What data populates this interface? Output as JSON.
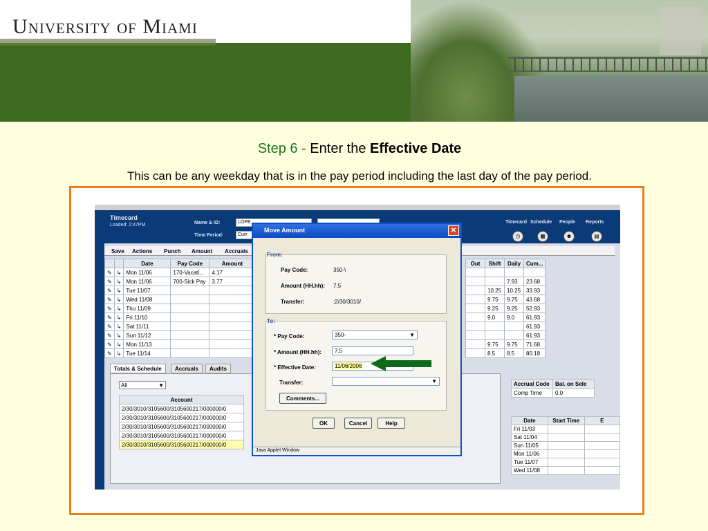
{
  "banner": {
    "logo": "University of Miami"
  },
  "heading": {
    "step": "Step 6 -",
    "text": "Enter the",
    "bold": "Effective Date"
  },
  "subtext": "This can be any weekday that is in the pay period including the last day of the pay period.",
  "app": {
    "title": "Timecard",
    "loaded": "Loaded: 2:47PM",
    "name_label": "Name & ID:",
    "name_value": "LOPE",
    "period_label": "Time Period:",
    "period_value": "Curr",
    "nav": [
      "Timecard",
      "Schedule",
      "People",
      "Reports"
    ],
    "menu": [
      "Save",
      "Actions",
      "Punch",
      "Amount",
      "Accruals"
    ],
    "grid_headers": [
      "Date",
      "Pay Code",
      "Amount"
    ],
    "grid_rows": [
      [
        "Mon 11/06",
        "170-Vacati...",
        "4.17"
      ],
      [
        "Mon 11/06",
        "700-Sick Pay",
        "3.77"
      ],
      [
        "Tue 11/07",
        "",
        ""
      ],
      [
        "Wed 11/08",
        "",
        ""
      ],
      [
        "Thu 11/09",
        "",
        ""
      ],
      [
        "Fri 11/10",
        "",
        ""
      ],
      [
        "Sat 11/11",
        "",
        ""
      ],
      [
        "Sun 11/12",
        "",
        ""
      ],
      [
        "Mon 11/13",
        "",
        ""
      ],
      [
        "Tue 11/14",
        "",
        ""
      ]
    ],
    "grid2_headers": [
      "Out",
      "Shift",
      "Daily",
      "Cum..."
    ],
    "grid2_rows": [
      [
        "",
        "",
        "",
        ""
      ],
      [
        "",
        "",
        "7.93",
        "23.68"
      ],
      [
        "",
        "10.25",
        "10.25",
        "33.93"
      ],
      [
        "",
        "9.75",
        "9.75",
        "43.68"
      ],
      [
        "",
        "9.25",
        "9.25",
        "52.93"
      ],
      [
        "",
        "9.0",
        "9.0",
        "61.93"
      ],
      [
        "",
        "",
        "",
        "61.93"
      ],
      [
        "",
        "",
        "",
        "61.93"
      ],
      [
        "",
        "9.75",
        "9.75",
        "71.68"
      ],
      [
        "",
        "8.5",
        "8.5",
        "80.18"
      ]
    ],
    "lower_tabs": [
      "Totals & Schedule",
      "Accruals",
      "Audits"
    ],
    "all_select": "All",
    "account_header": "Account",
    "accounts": [
      "2/30/3010/3105600/3105600217/000000/0",
      "2/30/3010/3105600/3105600217/000000/0",
      "2/30/3010/3105600/3105600217/000000/0",
      "2/30/3010/3105600/3105600217/000000/0",
      "2/30/3010/3105600/3105600217/000000/0"
    ],
    "accrual_headers": [
      "Accrual Code",
      "Bal. on Sele"
    ],
    "accrual_row": [
      "Comp Time",
      "0.0"
    ],
    "sched_headers": [
      "Date",
      "Start Time",
      "E"
    ],
    "sched_rows": [
      "Fri 11/03",
      "Sat 11/04",
      "Sun 11/05",
      "Mon 11/06",
      "Tue 11/07",
      "Wed 11/08"
    ]
  },
  "dialog": {
    "title": "Move Amount",
    "from_label": "From:",
    "from_paycode_label": "Pay Code:",
    "from_paycode_value": "350-\\",
    "from_amount_label": "Amount (HH.hh):",
    "from_amount_value": "7.5",
    "from_transfer_label": "Transfer:",
    "from_transfer_value": ";2/30/3010/",
    "to_label": "To:",
    "to_paycode_label": "* Pay Code:",
    "to_paycode_value": "350-",
    "to_amount_label": "* Amount (HH.hh):",
    "to_amount_value": "7.5",
    "to_date_label": "* Effective Date:",
    "to_date_value": "11/06/2006",
    "to_transfer_label": "Transfer:",
    "comments_button": "Comments...",
    "ok": "OK",
    "cancel": "Cancel",
    "help": "Help",
    "status": "Java Applet Window"
  },
  "colors": {
    "accent_orange": "#f07e14",
    "arrow_green": "#0a6a1a",
    "step_green": "#1a7a1a"
  }
}
